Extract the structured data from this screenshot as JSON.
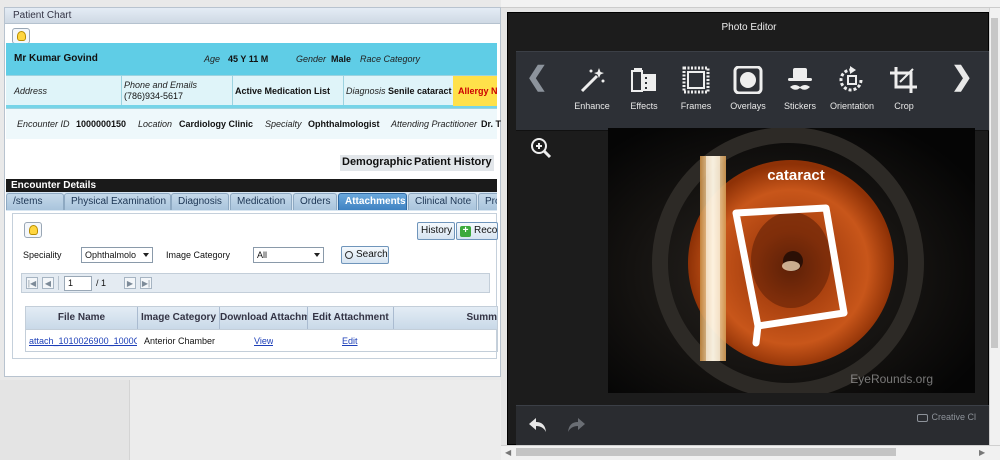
{
  "emr": {
    "window_title": "Patient Chart",
    "patient": {
      "name": "Mr Kumar Govind",
      "age_label": "Age",
      "age": "45 Y 11 M",
      "gender_label": "Gender",
      "gender": "Male",
      "race_label": "Race Category"
    },
    "row2": {
      "address_label": "Address",
      "phone_label": "Phone and Emails",
      "phone": "(786)934-5617",
      "meds_label": "Active Medication List",
      "diagnosis_label": "Diagnosis",
      "diagnosis": "Senile cataract",
      "allergy": "Allergy Ni"
    },
    "row3": {
      "encounter_label": "Encounter ID",
      "encounter_id": "1000000150",
      "location_label": "Location",
      "location": "Cardiology Clinic",
      "specialty_label": "Specialty",
      "specialty": "Ophthalmologist",
      "attending_label": "Attending Practitioner",
      "attending": "Dr. T"
    },
    "header_buttons": [
      "Demographic",
      "Patient History"
    ],
    "encounter_title": "Encounter Details",
    "tabs": [
      "/stems",
      "Physical Examination",
      "Diagnosis",
      "Medication",
      "Orders",
      "Attachments",
      "Clinical Note",
      "Pro"
    ],
    "active_tab": "Attachments",
    "attachments": {
      "history_button": "History",
      "record_button": "Record",
      "speciality_label": "Speciality",
      "speciality_value": "Ophthalmolo",
      "image_category_label": "Image Category",
      "image_category_value": "All",
      "search_button": "Search",
      "pager": {
        "page": "1",
        "of": "/ 1"
      },
      "columns": [
        "File Name",
        "Image Category",
        "Download Attachm",
        "Edit Attachment",
        "Summ"
      ],
      "rows": [
        {
          "file_name": "attach_1010026900_1000C",
          "image_category": "Anterior Chamber",
          "download": "View",
          "edit": "Edit"
        }
      ]
    }
  },
  "editor": {
    "title": "Photo Editor",
    "tools": [
      {
        "label": "Enhance",
        "icon": "magic-wand-icon"
      },
      {
        "label": "Effects",
        "icon": "film-effects-icon"
      },
      {
        "label": "Frames",
        "icon": "frame-icon"
      },
      {
        "label": "Overlays",
        "icon": "overlay-icon"
      },
      {
        "label": "Stickers",
        "icon": "hat-mustache-icon"
      },
      {
        "label": "Orientation",
        "icon": "rotate-icon"
      },
      {
        "label": "Crop",
        "icon": "crop-icon"
      }
    ],
    "photo": {
      "annotation": "cataract",
      "watermark": "EyeRounds.org"
    },
    "credit": "Creative Cl"
  }
}
